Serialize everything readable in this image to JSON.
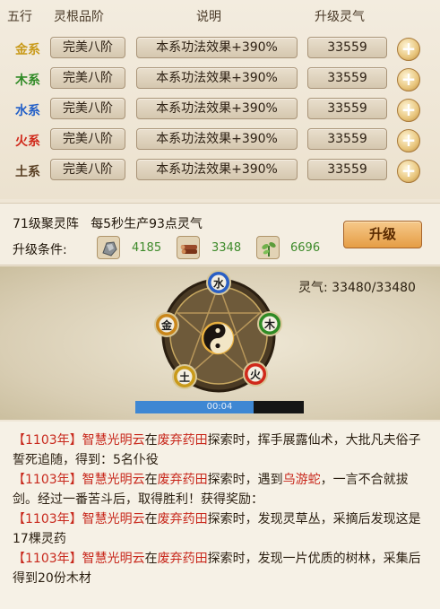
{
  "table": {
    "headers": {
      "element": "五行",
      "grade": "灵根品阶",
      "description": "说明",
      "cost": "升级灵气"
    },
    "rows": [
      {
        "element": "金系",
        "color": "#c99a1a",
        "grade": "完美八阶",
        "description": "本系功法效果+390%",
        "cost": "33559"
      },
      {
        "element": "木系",
        "color": "#2f8a25",
        "grade": "完美八阶",
        "description": "本系功法效果+390%",
        "cost": "33559"
      },
      {
        "element": "水系",
        "color": "#2460c8",
        "grade": "完美八阶",
        "description": "本系功法效果+390%",
        "cost": "33559"
      },
      {
        "element": "火系",
        "color": "#d0281a",
        "grade": "完美八阶",
        "description": "本系功法效果+390%",
        "cost": "33559"
      },
      {
        "element": "土系",
        "color": "#5a4024",
        "grade": "完美八阶",
        "description": "本系功法效果+390%",
        "cost": "33559"
      }
    ],
    "plus_label": "+"
  },
  "gather": {
    "title": "71级聚灵阵",
    "production": "每5秒生产93点灵气",
    "condition_label": "升级条件:",
    "resources": [
      {
        "icon": "ore-icon",
        "value": "4185"
      },
      {
        "icon": "wood-icon",
        "value": "3348"
      },
      {
        "icon": "herb-icon",
        "value": "6696"
      }
    ],
    "upgrade_label": "升级"
  },
  "scene": {
    "lingqi_label": "灵气:",
    "lingqi_value": "33480/33480",
    "elements": [
      {
        "char": "水",
        "color": "#2a5fc4"
      },
      {
        "char": "木",
        "color": "#2f8a25"
      },
      {
        "char": "火",
        "color": "#d0281a"
      },
      {
        "char": "土",
        "color": "#c99a1a"
      },
      {
        "char": "金",
        "color": "#c9861a"
      }
    ],
    "video_time": "00:04",
    "video_progress": 0.7
  },
  "log": [
    {
      "year": "【1103年】",
      "name": "智慧光明云",
      "mid": "在",
      "place": "废弃药田",
      "rest": "探索时，挥手展露仙术，大批凡夫俗子誓死追随，得到：5名仆役"
    },
    {
      "year": "【1103年】",
      "name": "智慧光明云",
      "mid": "在",
      "place": "废弃药田",
      "rest1": "探索时，遇到",
      "monster": "乌游蛇",
      "rest": "，一言不合就拔剑。经过一番苦斗后，取得胜利！获得奖励："
    },
    {
      "year": "【1103年】",
      "name": "智慧光明云",
      "mid": "在",
      "place": "废弃药田",
      "rest": "探索时，发现灵草丛，采摘后发现这是17棵灵药"
    },
    {
      "year": "【1103年】",
      "name": "智慧光明云",
      "mid": "在",
      "place": "废弃药田",
      "rest": "探索时，发现一片优质的树林，采集后得到20份木材"
    }
  ]
}
